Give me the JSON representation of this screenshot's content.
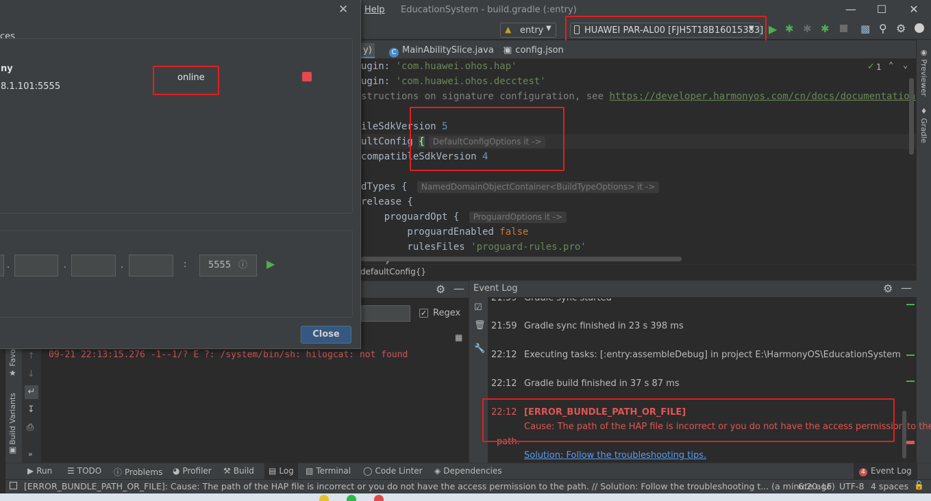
{
  "window": {
    "menu_help": "Help",
    "title": "EducationSystem - build.gradle (:entry)"
  },
  "toolbar": {
    "module_select": "entry",
    "device_select": "HUAWEI PAR-AL00 [FJH5T18B16015383]"
  },
  "tabs": [
    {
      "label": "y)"
    },
    {
      "label": "MainAbilitySlice.java",
      "icon_letter": "C"
    },
    {
      "label": "config.json"
    }
  ],
  "editor": {
    "lines": [
      {
        "code": "ugin: ",
        "str": "'com.huawei.ohos.hap'"
      },
      {
        "code": "ugin: ",
        "str": "'com.huawei.ohos.decctest'"
      },
      {
        "code": "structions on signature configuration, see ",
        "link": "https://developer.harmonyos.com/cn/docs/documentation/doc-g"
      },
      {
        "code": ""
      },
      {
        "code": "ileSdkVersion ",
        "num": "5"
      },
      {
        "code": "ultConfig ",
        "brace": "{",
        "hint": "DefaultConfigOptions it ->"
      },
      {
        "code": "compatibleSdkVersion ",
        "num": "4"
      },
      {
        "code": ""
      },
      {
        "code": "dTypes { ",
        "hint": "NamedDomainObjectContainer<BuildTypeOptions> it ->"
      },
      {
        "code": "release {"
      },
      {
        "code": "    proguardOpt { ",
        "hint": "ProguardOptions it ->"
      },
      {
        "code": "        proguardEnabled ",
        "kw": "false"
      },
      {
        "code": "        rulesFiles ",
        "str": "'proguard-rules.pro'"
      },
      {
        "code": "    }"
      }
    ],
    "inspection_count": "1",
    "breadcrumb": "defaultConfig{}"
  },
  "right_strip": {
    "previewer": "Previewer",
    "gradle": "Gradle"
  },
  "left_strip": {
    "favorites": "Favo",
    "build_variants": "Build Variants"
  },
  "log_panel": {
    "regex_label": "Regex",
    "log_line": "09-21 22:13:15.276 -1--1/? E ?:  /system/bin/sh: hilogcat: not found"
  },
  "event_log": {
    "title": "Event Log",
    "entries": [
      {
        "time": "21:59",
        "text": "Gradle sync started"
      },
      {
        "time": "21:59",
        "text": "Gradle sync finished in 23 s 398 ms"
      },
      {
        "time": "22:12",
        "text": "Executing tasks: [:entry:assembleDebug] in project E:\\HarmonyOS\\EducationSystem"
      },
      {
        "time": "22:12",
        "text": "Gradle build finished in 37 s 87 ms"
      }
    ],
    "error": {
      "time": "22:12",
      "title": "[ERROR_BUNDLE_PATH_OR_FILE]",
      "cause": "Cause: The path of the HAP file is incorrect or you do not have the access permission to the",
      "cause_cont": "path.",
      "solution": "Solution: Follow the troubleshooting tips."
    }
  },
  "bottom_tools": [
    {
      "label": "Run"
    },
    {
      "label": "TODO"
    },
    {
      "label": "Problems"
    },
    {
      "label": "Profiler"
    },
    {
      "label": "Build"
    },
    {
      "label": "Log"
    },
    {
      "label": "Terminal"
    },
    {
      "label": "Code Linter"
    },
    {
      "label": "Dependencies"
    }
  ],
  "event_log_button": {
    "badge": "4",
    "label": "Event Log"
  },
  "status": {
    "message": "[ERROR_BUNDLE_PATH_OR_FILE]: Cause: The path of the HAP file is incorrect or you do not have the access permission to the path. // Solution: Follow the troubleshooting t... (a minute ago)",
    "position": "6:20",
    "line_sep": "LF",
    "encoding": "UTF-8",
    "indent": "4 spaces"
  },
  "dialog": {
    "group_title": "ces",
    "device_name": "ny",
    "device_addr": "8.1.101:5555",
    "device_status": "online",
    "port": "5555",
    "close_label": "Close"
  },
  "colors": {
    "accent_red": "#e02020",
    "run_green": "#4caf50"
  }
}
